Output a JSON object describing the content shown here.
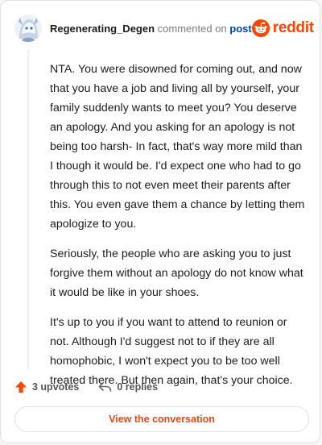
{
  "header": {
    "username": "Regenerating_Degen",
    "action_text": "commented on",
    "post_link": "post",
    "brand_wordmark": "reddit",
    "avatar_icon": "anime-avatar-icon",
    "brand_icon": "reddit-snoo-icon"
  },
  "comment": {
    "paragraphs": [
      "NTA. You were disowned for coming out, and now that you have a job and living all by yourself, your family suddenly wants to meet you? You deserve an apology. And you asking for an apology is not being too harsh- In fact, that's way more mild than I though it would be. I'd expect one who had to go through this to not even meet their parents after this. You even gave them a chance by letting them apologize to you.",
      "Seriously, the people who are asking you to just forgive them without an apology do not know what it would be like in your shoes.",
      "It's up to you if you want to attend to reunion or not. Although I'd suggest not to if they are all homophobic, I won't expect you to be too well treated there. But then again, that's your choice."
    ]
  },
  "actions": {
    "upvotes": "3 upvotes",
    "replies": "0 replies",
    "upvote_icon": "upvote-arrow-icon",
    "reply_icon": "reply-arrow-icon"
  },
  "cta": {
    "label": "View the conversation"
  },
  "colors": {
    "brand": "#ff4500",
    "link": "#0045ac",
    "cta_text": "#e34a1d",
    "text": "#1c1c1c",
    "muted": "#7c7c7c"
  }
}
